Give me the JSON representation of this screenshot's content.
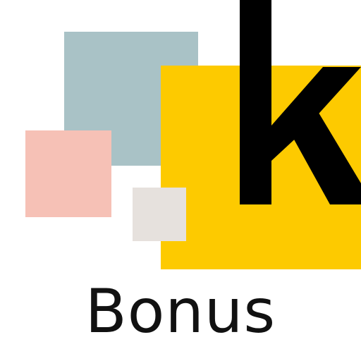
{
  "app_icon": {
    "wordmark": "Bonus",
    "letter_mark": "k",
    "letter_mark_icon": "letter-k-icon",
    "colors": {
      "background": "#ffffff",
      "blue_square": "#a9c2c6",
      "yellow_square": "#fdca00",
      "pink_square": "#f6c1b6",
      "grey_square": "#e6e1dd",
      "letter_color": "#000000",
      "text_color": "#111111"
    }
  }
}
